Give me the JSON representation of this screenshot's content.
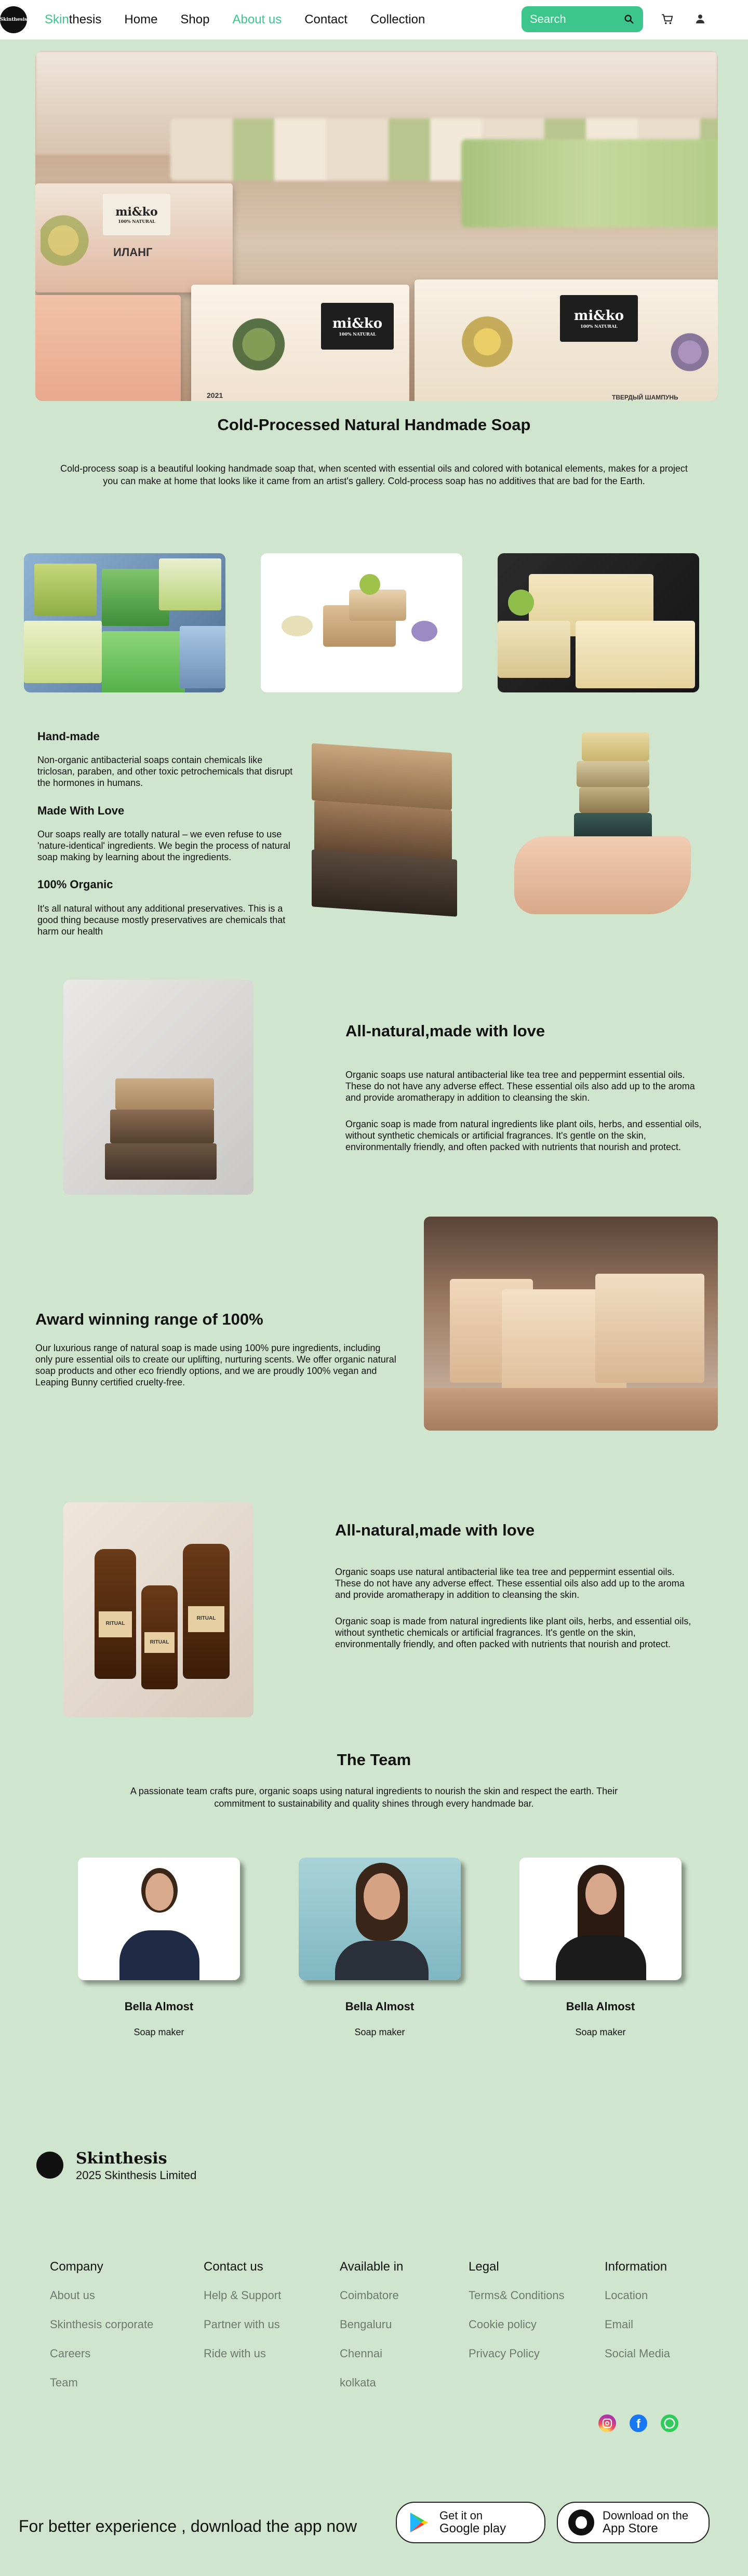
{
  "nav": {
    "brand_prefix": "Skin",
    "brand_suffix": "thesis",
    "logo_text": "Skinthesis",
    "links": [
      "Home",
      "Shop",
      "About us",
      "Contact",
      "Collection"
    ],
    "active_link": "About us",
    "search_placeholder": "Search"
  },
  "hero": {
    "title": "Cold-Processed Natural Handmade Soap",
    "description": "Cold-process soap is a beautiful looking handmade soap that, when scented with essential oils and colored with botanical elements, makes for a project you can make at home that looks like it came from an artist's gallery. Cold-process soap has no additives that are bad for the Earth.",
    "box_brand": "mi&ko",
    "box_sub": "100% NATURAL",
    "box_year": "2021",
    "box_text1": "ТВЕРДЫЙ ШАМПУНЬ",
    "box_text2": "ИЛАНГ"
  },
  "features": [
    {
      "title": "Hand-made",
      "text": "Non-organic antibacterial soaps contain chemicals like triclosan, paraben, and other toxic petrochemicals that disrupt the hormones in humans."
    },
    {
      "title": "Made With Love",
      "text": "Our soaps really are totally natural – we even refuse to use 'nature-identical' ingredients. We begin the process of natural soap making by learning about the ingredients."
    },
    {
      "title": "100% Organic",
      "text": "It's all natural without any additional preservatives. This is a good thing because mostly preservatives are chemicals that harm our health"
    }
  ],
  "section1": {
    "title": "All-natural,made with love",
    "p1": "Organic soaps use natural antibacterial like tea tree and peppermint essential oils. These do not have any adverse effect. These essential oils also add up to the aroma and provide aromatherapy in addition to cleansing the skin.",
    "p2": "Organic soap is made from natural ingredients like plant oils, herbs, and essential oils, without synthetic chemicals or artificial fragrances. It's gentle on the skin, environmentally friendly, and often packed with nutrients that nourish and protect."
  },
  "section2": {
    "title": "Award winning range of 100%",
    "p1": "Our luxurious range of natural soap is made using 100% pure ingredients, including only pure essential oils to create our uplifting, nurturing scents. We offer organic natural soap products and other eco friendly options, and we are proudly 100% vegan and Leaping Bunny certified cruelty-free."
  },
  "section3": {
    "title": "All-natural,made with love",
    "p1": "Organic soaps use natural antibacterial like tea tree and peppermint essential oils. These do not have any adverse effect. These essential oils also add up to the aroma and provide aromatherapy in addition to cleansing the skin.",
    "p2": "Organic soap is made from natural ingredients like plant oils, herbs, and essential oils, without synthetic chemicals or artificial fragrances. It's gentle on the skin, environmentally friendly, and often packed with nutrients that nourish and protect.",
    "bottle_label": "RITUAL"
  },
  "team": {
    "title": "The Team",
    "description": "A passionate team crafts pure, organic soaps using natural ingredients to nourish the skin and respect the earth. Their commitment to sustainability and quality shines through every handmade bar.",
    "members": [
      {
        "name": "Bella Almost",
        "role": "Soap maker"
      },
      {
        "name": "Bella Almost",
        "role": "Soap maker"
      },
      {
        "name": "Bella Almost",
        "role": "Soap maker"
      }
    ]
  },
  "footer": {
    "brand": "Skinthesis",
    "copyright": "2025 Skinthesis Limited",
    "columns": [
      {
        "title": "Company",
        "links": [
          "About us",
          "Skinthesis corporate",
          "Careers",
          "Team"
        ]
      },
      {
        "title": "Contact us",
        "links": [
          "Help & Support",
          "Partner with us",
          "Ride with us"
        ]
      },
      {
        "title": "Available in",
        "links": [
          "Coimbatore",
          "Bengaluru",
          "Chennai",
          "kolkata"
        ]
      },
      {
        "title": "Legal",
        "links": [
          "Terms& Conditions",
          "Cookie policy",
          "Privacy Policy"
        ]
      },
      {
        "title": "Information",
        "links": [
          "Location",
          "Email",
          "Social Media"
        ]
      }
    ],
    "socials": [
      "instagram-icon",
      "facebook-icon",
      "whatsapp-icon"
    ],
    "app_text": "For better experience , download the app now",
    "google": {
      "line1": "Get it on",
      "line2": "Google play"
    },
    "apple": {
      "line1": "Download on the",
      "line2": "App Store"
    }
  },
  "colors": {
    "accent": "#3cc58c",
    "background": "#cfe5ce"
  }
}
